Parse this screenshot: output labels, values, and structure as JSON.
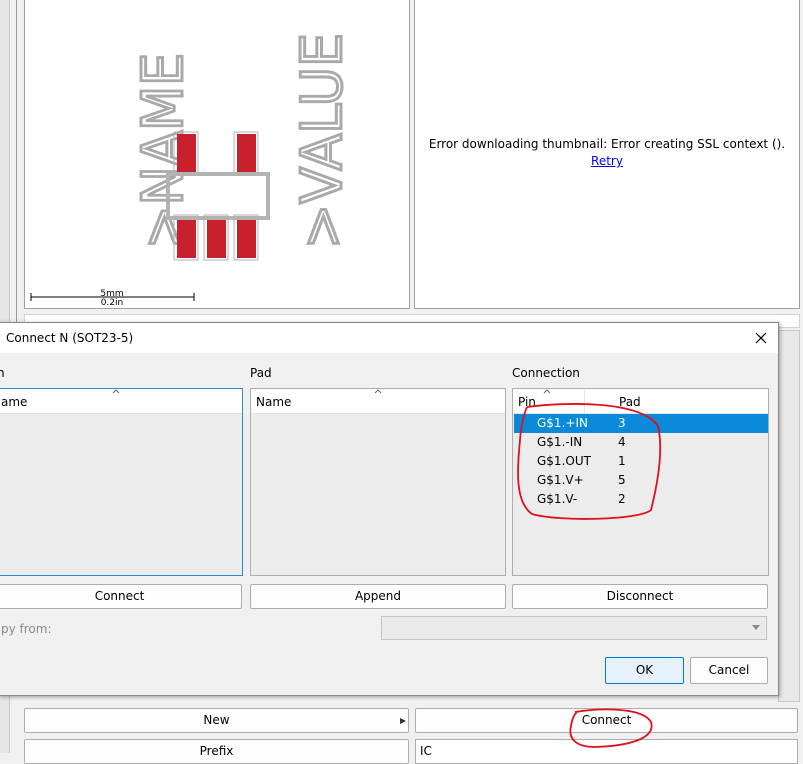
{
  "preview": {
    "name_text": ">NAME",
    "value_text": ">VALUE",
    "scale_mm": "5mm",
    "scale_in": "0.2in",
    "colors": {
      "pad": "#c8202c",
      "outline": "#b3b3b3",
      "text": "#a9a9a9"
    }
  },
  "thumbnail": {
    "error": "Error downloading thumbnail: Error creating SSL context ().",
    "retry": "Retry"
  },
  "dialog": {
    "title": "Connect N (SOT23-5)",
    "close_icon": "close-icon",
    "pin_section_label": "n",
    "pin_col_header": "ame",
    "pad_section_label": "Pad",
    "pad_col_header": "Name",
    "connection_section_label": "Connection",
    "connection_headers": {
      "pin": "Pin",
      "pad": "Pad"
    },
    "connections": [
      {
        "pin": "G$1.+IN",
        "pad": "3",
        "selected": true
      },
      {
        "pin": "G$1.-IN",
        "pad": "4",
        "selected": false
      },
      {
        "pin": "G$1.OUT",
        "pad": "1",
        "selected": false
      },
      {
        "pin": "G$1.V+",
        "pad": "5",
        "selected": false
      },
      {
        "pin": "G$1.V-",
        "pad": "2",
        "selected": false
      }
    ],
    "connect_button": "Connect",
    "append_button": "Append",
    "disconnect_button": "Disconnect",
    "copy_from_label": "py from:",
    "copy_from_value": "",
    "ok_button": "OK",
    "cancel_button": "Cancel",
    "colors": {
      "selection": "#0a8ad8",
      "focus_border": "#2e8ecb",
      "annotation": "#e0101e"
    }
  },
  "bottom": {
    "new_button": "New",
    "connect_button": "Connect",
    "prefix_button": "Prefix",
    "prefix_value": "IC"
  }
}
